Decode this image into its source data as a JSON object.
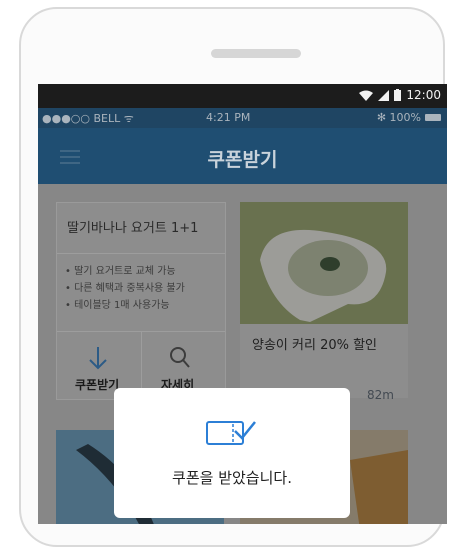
{
  "android_status": {
    "time": "12:00"
  },
  "ios_status": {
    "carrier": "●●●○○ BELL ᯤ",
    "time": "4:21 PM",
    "battery": "✻ 100%"
  },
  "appbar": {
    "title": "쿠폰받기"
  },
  "coupon_card": {
    "title": "딸기바나나 요거트 1+1",
    "conditions": [
      "• 딸기 요거트로 교체 가능",
      "• 다른 혜택과 중복사용 불가",
      "• 테이블당 1매 사용가능"
    ],
    "get_button": "쿠폰받기",
    "detail_button": "자세히"
  },
  "store_card": {
    "title": "양송이 커리 20% 할인",
    "distance": "82m"
  },
  "toast": {
    "message": "쿠폰을 받았습니다."
  },
  "colors": {
    "accent": "#2c7fd6",
    "dialog_bg": "#ffffff"
  }
}
